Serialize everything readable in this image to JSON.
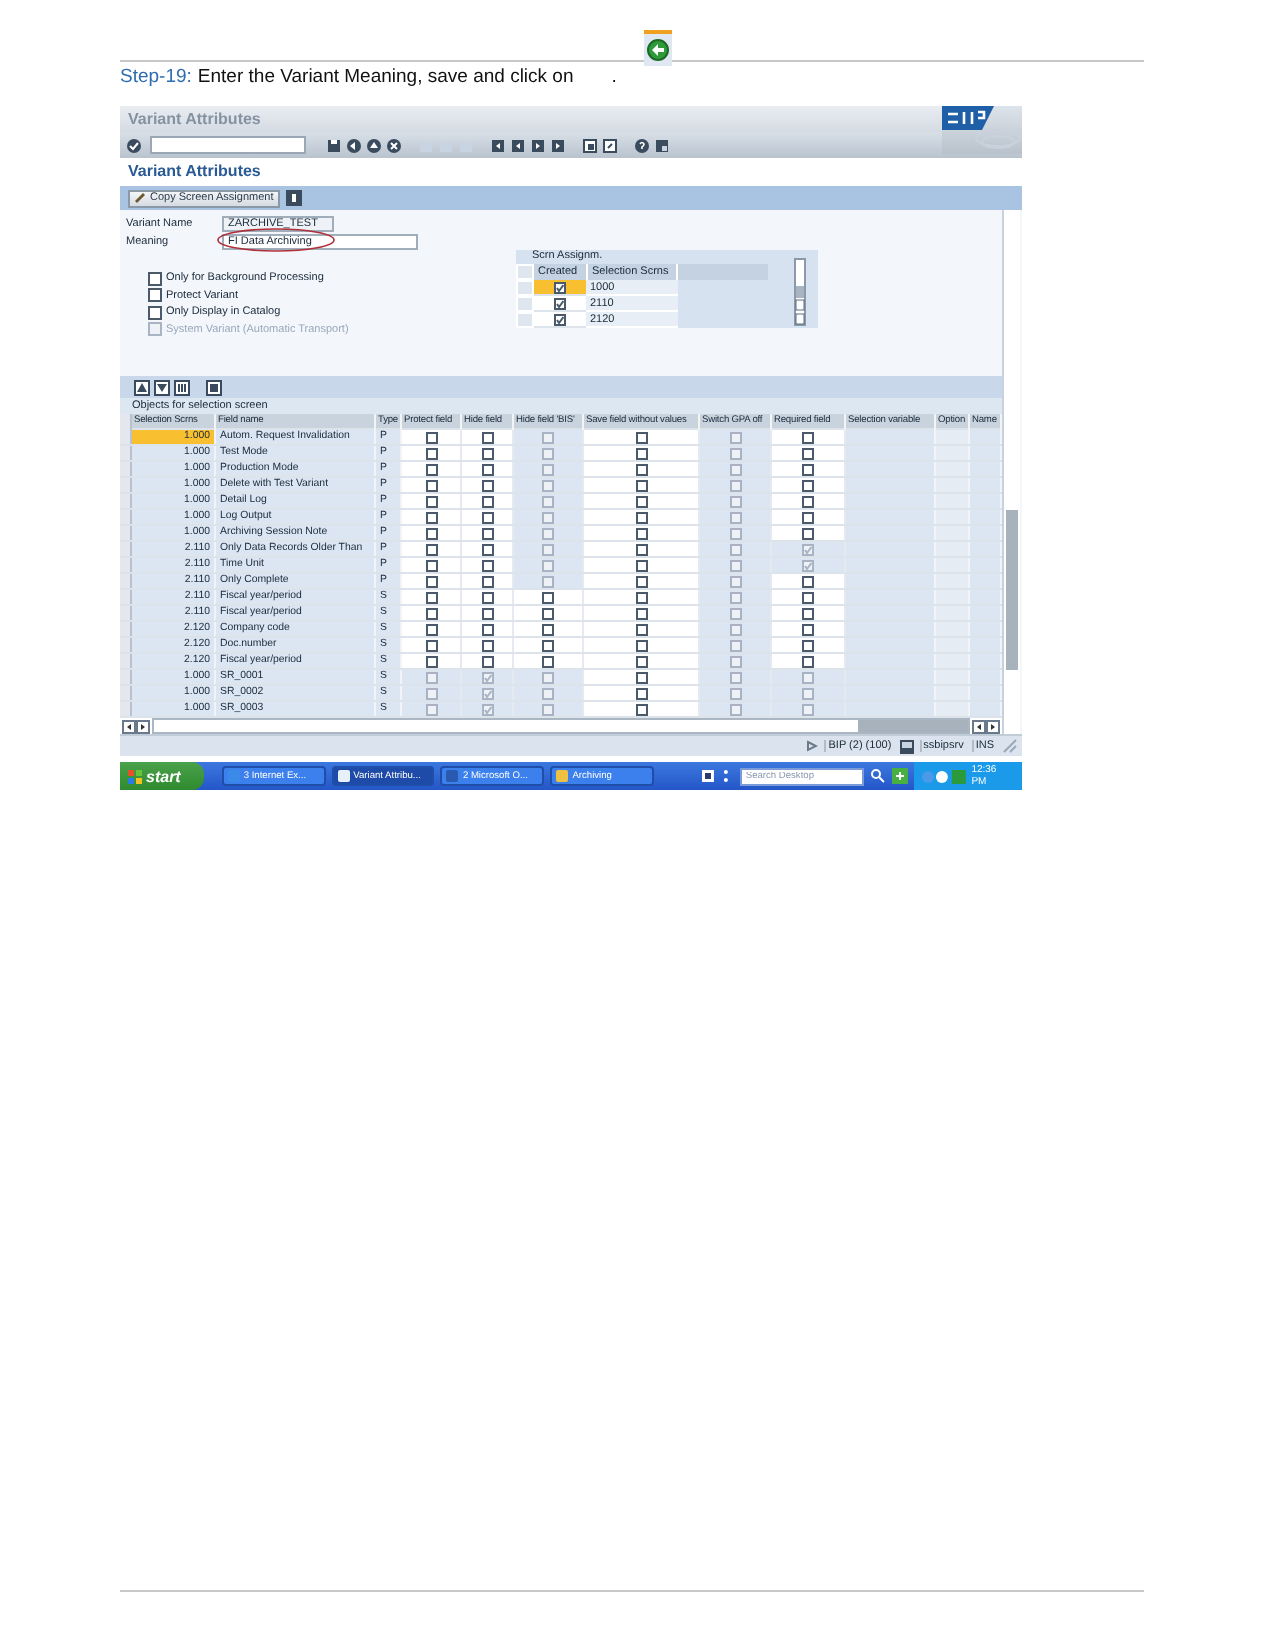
{
  "step": {
    "label": "Step-19:",
    "text": "Enter the Variant Meaning, save and click on",
    "end": "."
  },
  "window": {
    "title": "Variant Attributes",
    "screen_title": "Variant Attributes"
  },
  "app_toolbar": {
    "buttons": [
      "Copy Screen Assignment"
    ]
  },
  "form": {
    "fields": [
      {
        "label": "Variant Name",
        "value": "ZARCHIVE_TEST",
        "readonly": true,
        "circled": false
      },
      {
        "label": "Meaning",
        "value": "FI Data Archiving",
        "readonly": false,
        "circled": true
      }
    ],
    "options": [
      {
        "label": "Only for Background Processing",
        "checked": false,
        "disabled": false
      },
      {
        "label": "Protect Variant",
        "checked": false,
        "disabled": false
      },
      {
        "label": "Only Display in Catalog",
        "checked": false,
        "disabled": false
      },
      {
        "label": "System Variant (Automatic Transport)",
        "checked": false,
        "disabled": true
      }
    ]
  },
  "screen_assignment": {
    "title": "Scrn Assignm.",
    "columns": [
      "Created",
      "Selection Scrns"
    ],
    "rows": [
      {
        "created": true,
        "screen": "1000",
        "selected": true
      },
      {
        "created": true,
        "screen": "2110",
        "selected": false
      },
      {
        "created": true,
        "screen": "2120",
        "selected": false
      }
    ]
  },
  "objects": {
    "title": "Objects for selection screen",
    "columns": [
      "Selection Scrns",
      "Field name",
      "Type",
      "Protect field",
      "Hide field",
      "Hide field 'BIS'",
      "Save field without values",
      "Switch GPA off",
      "Required field",
      "Selection variable",
      "Option",
      "Name"
    ],
    "rows": [
      {
        "screen": "1.000",
        "field": "Autom. Request Invalidation",
        "type": "P",
        "selected": true,
        "cells": [
          {
            "checked": false,
            "disabled": false
          },
          {
            "checked": false,
            "disabled": false
          },
          {
            "checked": false,
            "disabled": true
          },
          {
            "checked": false,
            "disabled": false
          },
          {
            "checked": false,
            "disabled": true
          },
          {
            "checked": false,
            "disabled": false
          }
        ]
      },
      {
        "screen": "1.000",
        "field": "Test Mode",
        "type": "P",
        "selected": false,
        "cells": [
          {
            "checked": false,
            "disabled": false
          },
          {
            "checked": false,
            "disabled": false
          },
          {
            "checked": false,
            "disabled": true
          },
          {
            "checked": false,
            "disabled": false
          },
          {
            "checked": false,
            "disabled": true
          },
          {
            "checked": false,
            "disabled": false
          }
        ]
      },
      {
        "screen": "1.000",
        "field": "Production Mode",
        "type": "P",
        "selected": false,
        "cells": [
          {
            "checked": false,
            "disabled": false
          },
          {
            "checked": false,
            "disabled": false
          },
          {
            "checked": false,
            "disabled": true
          },
          {
            "checked": false,
            "disabled": false
          },
          {
            "checked": false,
            "disabled": true
          },
          {
            "checked": false,
            "disabled": false
          }
        ]
      },
      {
        "screen": "1.000",
        "field": "Delete with Test Variant",
        "type": "P",
        "selected": false,
        "cells": [
          {
            "checked": false,
            "disabled": false
          },
          {
            "checked": false,
            "disabled": false
          },
          {
            "checked": false,
            "disabled": true
          },
          {
            "checked": false,
            "disabled": false
          },
          {
            "checked": false,
            "disabled": true
          },
          {
            "checked": false,
            "disabled": false
          }
        ]
      },
      {
        "screen": "1.000",
        "field": "Detail Log",
        "type": "P",
        "selected": false,
        "cells": [
          {
            "checked": false,
            "disabled": false
          },
          {
            "checked": false,
            "disabled": false
          },
          {
            "checked": false,
            "disabled": true
          },
          {
            "checked": false,
            "disabled": false
          },
          {
            "checked": false,
            "disabled": true
          },
          {
            "checked": false,
            "disabled": false
          }
        ]
      },
      {
        "screen": "1.000",
        "field": "Log Output",
        "type": "P",
        "selected": false,
        "cells": [
          {
            "checked": false,
            "disabled": false
          },
          {
            "checked": false,
            "disabled": false
          },
          {
            "checked": false,
            "disabled": true
          },
          {
            "checked": false,
            "disabled": false
          },
          {
            "checked": false,
            "disabled": true
          },
          {
            "checked": false,
            "disabled": false
          }
        ]
      },
      {
        "screen": "1.000",
        "field": "Archiving Session Note",
        "type": "P",
        "selected": false,
        "cells": [
          {
            "checked": false,
            "disabled": false
          },
          {
            "checked": false,
            "disabled": false
          },
          {
            "checked": false,
            "disabled": true
          },
          {
            "checked": false,
            "disabled": false
          },
          {
            "checked": false,
            "disabled": true
          },
          {
            "checked": false,
            "disabled": false
          }
        ]
      },
      {
        "screen": "2.110",
        "field": "Only Data Records Older Than",
        "type": "P",
        "selected": false,
        "cells": [
          {
            "checked": false,
            "disabled": false
          },
          {
            "checked": false,
            "disabled": false
          },
          {
            "checked": false,
            "disabled": true
          },
          {
            "checked": false,
            "disabled": false
          },
          {
            "checked": false,
            "disabled": true
          },
          {
            "checked": true,
            "disabled": true
          }
        ]
      },
      {
        "screen": "2.110",
        "field": "Time Unit",
        "type": "P",
        "selected": false,
        "cells": [
          {
            "checked": false,
            "disabled": false
          },
          {
            "checked": false,
            "disabled": false
          },
          {
            "checked": false,
            "disabled": true
          },
          {
            "checked": false,
            "disabled": false
          },
          {
            "checked": false,
            "disabled": true
          },
          {
            "checked": true,
            "disabled": true
          }
        ]
      },
      {
        "screen": "2.110",
        "field": "Only Complete",
        "type": "P",
        "selected": false,
        "cells": [
          {
            "checked": false,
            "disabled": false
          },
          {
            "checked": false,
            "disabled": false
          },
          {
            "checked": false,
            "disabled": true
          },
          {
            "checked": false,
            "disabled": false
          },
          {
            "checked": false,
            "disabled": true
          },
          {
            "checked": false,
            "disabled": false
          }
        ]
      },
      {
        "screen": "2.110",
        "field": "Fiscal year/period",
        "type": "S",
        "selected": false,
        "cells": [
          {
            "checked": false,
            "disabled": false
          },
          {
            "checked": false,
            "disabled": false
          },
          {
            "checked": false,
            "disabled": false
          },
          {
            "checked": false,
            "disabled": false
          },
          {
            "checked": false,
            "disabled": true
          },
          {
            "checked": false,
            "disabled": false
          }
        ]
      },
      {
        "screen": "2.110",
        "field": "Fiscal year/period",
        "type": "S",
        "selected": false,
        "cells": [
          {
            "checked": false,
            "disabled": false
          },
          {
            "checked": false,
            "disabled": false
          },
          {
            "checked": false,
            "disabled": false
          },
          {
            "checked": false,
            "disabled": false
          },
          {
            "checked": false,
            "disabled": true
          },
          {
            "checked": false,
            "disabled": false
          }
        ]
      },
      {
        "screen": "2.120",
        "field": "Company code",
        "type": "S",
        "selected": false,
        "cells": [
          {
            "checked": false,
            "disabled": false
          },
          {
            "checked": false,
            "disabled": false
          },
          {
            "checked": false,
            "disabled": false
          },
          {
            "checked": false,
            "disabled": false
          },
          {
            "checked": false,
            "disabled": true
          },
          {
            "checked": false,
            "disabled": false
          }
        ]
      },
      {
        "screen": "2.120",
        "field": "Doc.number",
        "type": "S",
        "selected": false,
        "cells": [
          {
            "checked": false,
            "disabled": false
          },
          {
            "checked": false,
            "disabled": false
          },
          {
            "checked": false,
            "disabled": false
          },
          {
            "checked": false,
            "disabled": false
          },
          {
            "checked": false,
            "disabled": true
          },
          {
            "checked": false,
            "disabled": false
          }
        ]
      },
      {
        "screen": "2.120",
        "field": "Fiscal year/period",
        "type": "S",
        "selected": false,
        "cells": [
          {
            "checked": false,
            "disabled": false
          },
          {
            "checked": false,
            "disabled": false
          },
          {
            "checked": false,
            "disabled": false
          },
          {
            "checked": false,
            "disabled": false
          },
          {
            "checked": false,
            "disabled": true
          },
          {
            "checked": false,
            "disabled": false
          }
        ]
      },
      {
        "screen": "1.000",
        "field": "SR_0001",
        "type": "S",
        "selected": false,
        "cells": [
          {
            "checked": false,
            "disabled": true
          },
          {
            "checked": true,
            "disabled": true
          },
          {
            "checked": false,
            "disabled": true
          },
          {
            "checked": false,
            "disabled": false
          },
          {
            "checked": false,
            "disabled": true
          },
          {
            "checked": false,
            "disabled": true
          }
        ]
      },
      {
        "screen": "1.000",
        "field": "SR_0002",
        "type": "S",
        "selected": false,
        "cells": [
          {
            "checked": false,
            "disabled": true
          },
          {
            "checked": true,
            "disabled": true
          },
          {
            "checked": false,
            "disabled": true
          },
          {
            "checked": false,
            "disabled": false
          },
          {
            "checked": false,
            "disabled": true
          },
          {
            "checked": false,
            "disabled": true
          }
        ]
      },
      {
        "screen": "1.000",
        "field": "SR_0003",
        "type": "S",
        "selected": false,
        "cells": [
          {
            "checked": false,
            "disabled": true
          },
          {
            "checked": true,
            "disabled": true
          },
          {
            "checked": false,
            "disabled": true
          },
          {
            "checked": false,
            "disabled": false
          },
          {
            "checked": false,
            "disabled": true
          },
          {
            "checked": false,
            "disabled": true
          }
        ]
      }
    ]
  },
  "status_bar": {
    "items": [
      "BIP (2) (100)",
      "ssbipsrv",
      "INS"
    ]
  },
  "taskbar": {
    "start": "start",
    "tasks": [
      {
        "label": "3 Internet Ex...",
        "selected": false
      },
      {
        "label": "Variant Attribu...",
        "selected": true
      },
      {
        "label": "2 Microsoft O...",
        "selected": false
      },
      {
        "label": "Archiving",
        "selected": false
      }
    ],
    "search": {
      "placeholder": "Search Desktop"
    },
    "clock": "12:36 PM"
  }
}
